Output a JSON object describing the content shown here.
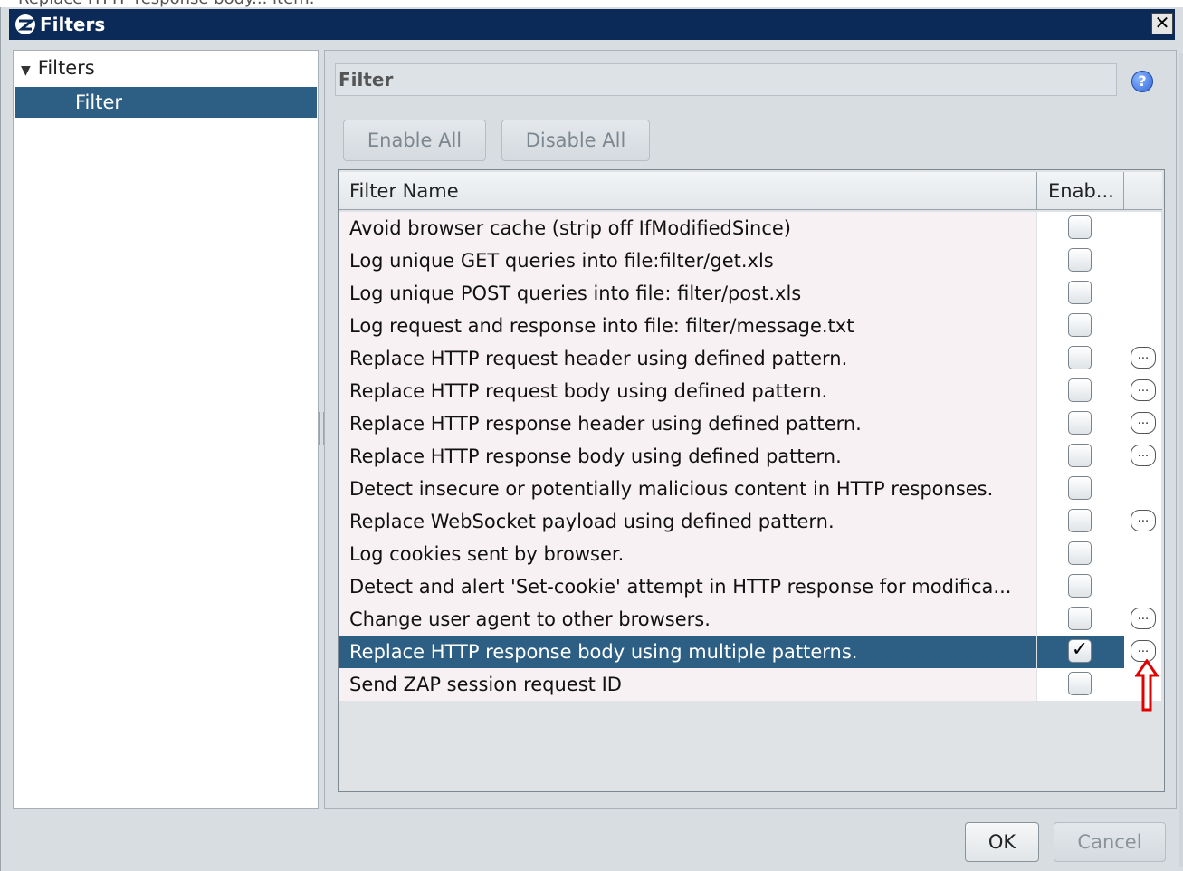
{
  "caption": "Replace HTTP response body... item.",
  "window": {
    "title": "Filters",
    "close_label": "✕"
  },
  "tree": {
    "root_label": "Filters",
    "child_label": "Filter"
  },
  "panel": {
    "header": "Filter",
    "help_label": "?",
    "enable_all": "Enable All",
    "disable_all": "Disable All"
  },
  "table": {
    "columns": [
      "Filter Name",
      "Enab..."
    ],
    "rows": [
      {
        "name": "Avoid browser cache (strip off IfModifiedSince)",
        "enabled": false,
        "has_options": false
      },
      {
        "name": "Log unique GET queries into file:filter/get.xls",
        "enabled": false,
        "has_options": false
      },
      {
        "name": "Log unique POST queries into file:  filter/post.xls",
        "enabled": false,
        "has_options": false
      },
      {
        "name": "Log request and response into file: filter/message.txt",
        "enabled": false,
        "has_options": false
      },
      {
        "name": "Replace HTTP request header using defined pattern.",
        "enabled": false,
        "has_options": true
      },
      {
        "name": "Replace HTTP request body using defined pattern.",
        "enabled": false,
        "has_options": true
      },
      {
        "name": "Replace HTTP response header using defined pattern.",
        "enabled": false,
        "has_options": true
      },
      {
        "name": "Replace HTTP response body using defined pattern.",
        "enabled": false,
        "has_options": true
      },
      {
        "name": "Detect insecure or potentially malicious content in HTTP responses.",
        "enabled": false,
        "has_options": false
      },
      {
        "name": "Replace WebSocket payload using defined pattern.",
        "enabled": false,
        "has_options": true
      },
      {
        "name": "Log cookies sent by browser.",
        "enabled": false,
        "has_options": false
      },
      {
        "name": "Detect and alert 'Set-cookie' attempt in HTTP response for modifica...",
        "enabled": false,
        "has_options": false
      },
      {
        "name": "Change user agent to other browsers.",
        "enabled": false,
        "has_options": true
      },
      {
        "name": "Replace HTTP response body using multiple patterns.",
        "enabled": true,
        "has_options": true,
        "selected": true
      },
      {
        "name": "Send ZAP session request ID",
        "enabled": false,
        "has_options": false
      }
    ],
    "check_mark": "✓",
    "options_label": "..."
  },
  "footer": {
    "ok": "OK",
    "cancel": "Cancel"
  },
  "icons": {
    "title_logo": "zap-logo-icon",
    "help": "help-icon",
    "arrow": "red-up-arrow-icon"
  },
  "colors": {
    "titlebar": "#0b2a57",
    "selection": "#2d5f85",
    "arrow": "#e00000"
  }
}
